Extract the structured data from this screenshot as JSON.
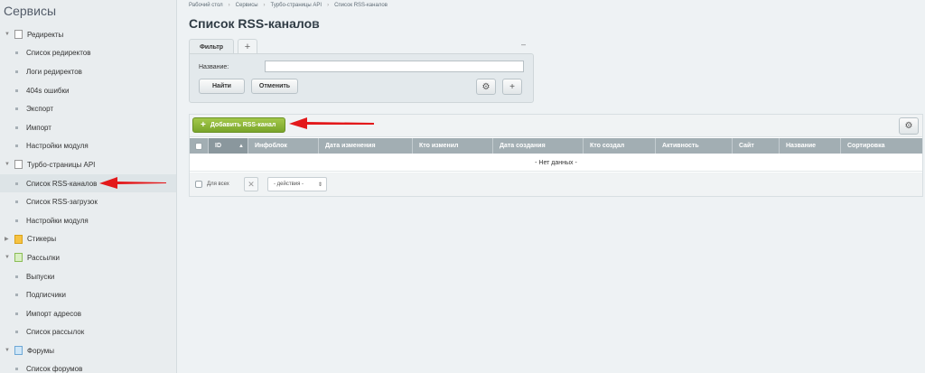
{
  "sidebar": {
    "title": "Сервисы",
    "items": [
      {
        "label": "Редиректы",
        "type": "group",
        "icon": "page-icon"
      },
      {
        "label": "Список редиректов",
        "type": "child"
      },
      {
        "label": "Логи редиректов",
        "type": "child"
      },
      {
        "label": "404s ошибки",
        "type": "child"
      },
      {
        "label": "Экспорт",
        "type": "child"
      },
      {
        "label": "Импорт",
        "type": "child"
      },
      {
        "label": "Настройки модуля",
        "type": "child"
      },
      {
        "label": "Турбо-страницы API",
        "type": "group",
        "icon": "page-icon"
      },
      {
        "label": "Список RSS-каналов",
        "type": "child",
        "active": true
      },
      {
        "label": "Список RSS-загрузок",
        "type": "child"
      },
      {
        "label": "Настройки модуля",
        "type": "child"
      },
      {
        "label": "Стикеры",
        "type": "group",
        "icon": "sticker-icon"
      },
      {
        "label": "Рассылки",
        "type": "group",
        "icon": "mail-icon"
      },
      {
        "label": "Выпуски",
        "type": "child"
      },
      {
        "label": "Подписчики",
        "type": "child"
      },
      {
        "label": "Импорт адресов",
        "type": "child"
      },
      {
        "label": "Список рассылок",
        "type": "child"
      },
      {
        "label": "Форумы",
        "type": "group",
        "icon": "forum-icon"
      },
      {
        "label": "Список форумов",
        "type": "child"
      }
    ]
  },
  "breadcrumb": [
    "Рабочий стол",
    "Сервисы",
    "Турбо-страницы API",
    "Список RSS-каналов"
  ],
  "page_title": "Список RSS-каналов",
  "filter": {
    "tab_label": "Фильтр",
    "add_tab": "+",
    "collapse": "–",
    "name_label": "Название:",
    "name_value": "",
    "find_button": "Найти",
    "cancel_button": "Отменить"
  },
  "grid": {
    "add_button": "Добавить RSS-канал",
    "columns": [
      "ID",
      "Инфоблок",
      "Дата изменения",
      "Кто изменил",
      "Дата создания",
      "Кто создал",
      "Активность",
      "Сайт",
      "Название",
      "Сортировка"
    ],
    "empty_text": "- Нет данных -",
    "for_all_label": "Для всех",
    "actions_select": "- действия -"
  },
  "colors": {
    "accent_green": "#7aa52b",
    "header_gray": "#a2aeb3",
    "annotation_red": "#e3191b"
  }
}
